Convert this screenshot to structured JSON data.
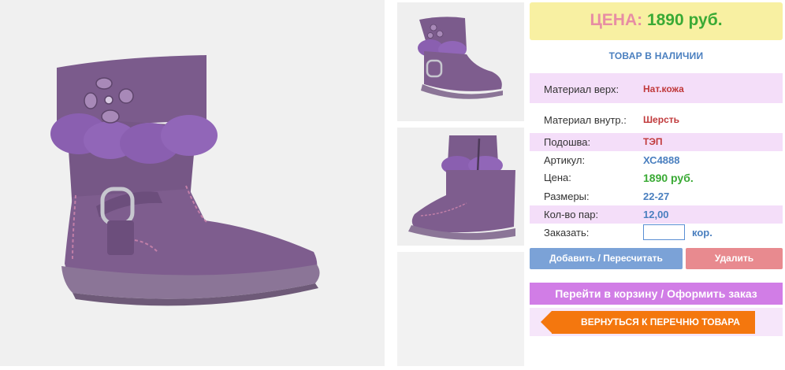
{
  "price_box": {
    "label": "ЦЕНА:",
    "value": "1890 руб."
  },
  "stock_status": "ТОВАР В НАЛИЧИИ",
  "specs": [
    {
      "key": "Материал верх:",
      "value": "Нат.кожа"
    },
    {
      "key": "Материал внутр.:",
      "value": "Шерсть"
    },
    {
      "key": "Подошва:",
      "value": "ТЭП"
    },
    {
      "key": "Артикул:",
      "value": "ХС4888"
    },
    {
      "key": "Цена:",
      "value": "1890 руб."
    },
    {
      "key": "Размеры:",
      "value": "22-27"
    },
    {
      "key": "Кол-во пар:",
      "value": "12,00"
    }
  ],
  "order": {
    "label": "Заказать:",
    "value": "",
    "unit": "кор."
  },
  "buttons": {
    "add": "Добавить / Пересчитать",
    "delete": "Удалить",
    "cart": "Перейти в корзину / Оформить заказ",
    "back": "ВЕРНУТЬСЯ К ПЕРЕЧНЮ ТОВАРА"
  },
  "colors": {
    "price_bg": "#f8f0a2",
    "price_label": "#e78da4",
    "price_value": "#3aaa35",
    "accent_blue": "#4a7fbf",
    "row_lilac": "#f4def9",
    "add_button": "#7ba2d7",
    "delete_button": "#e88a8f",
    "cart_button": "#d17de6",
    "back_button": "#f4770e",
    "product_purple": "#7a5a8c"
  }
}
